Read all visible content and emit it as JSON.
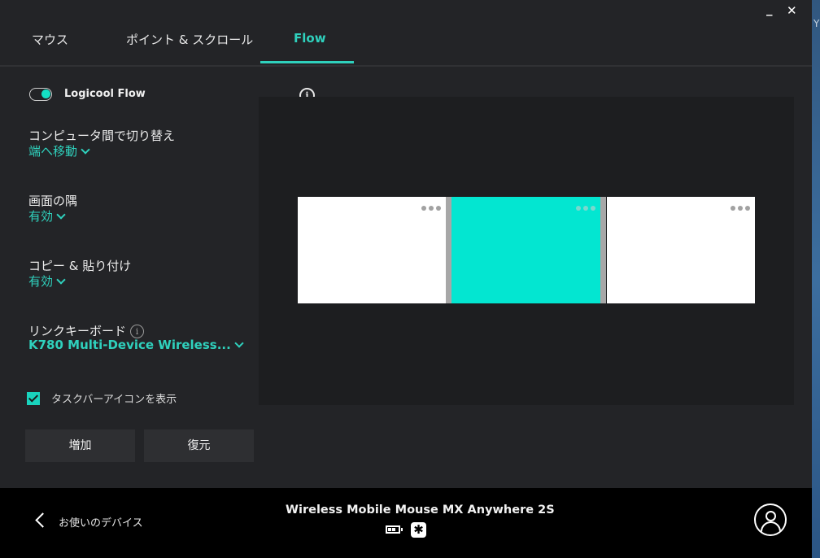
{
  "window": {
    "controls": {
      "minimize": "_",
      "close": "✕"
    }
  },
  "desktop": {
    "edge_text": "Y"
  },
  "tabs": [
    {
      "label": "マウス",
      "active": false
    },
    {
      "label": "ポイント & スクロール",
      "active": false
    },
    {
      "label": "Flow",
      "active": true
    }
  ],
  "flow": {
    "toggle": {
      "label": "Logicool Flow",
      "on": true
    },
    "settings": [
      {
        "title": "コンピュータ間で切り替え",
        "value": "端へ移動"
      },
      {
        "title": "画面の隅",
        "value": "有効"
      },
      {
        "title": "コピー & 貼り付け",
        "value": "有効"
      },
      {
        "title": "リンクキーボード",
        "value": "K780 Multi-Device Wireless...",
        "info_icon": "i"
      }
    ],
    "taskbar_checkbox": {
      "label": "タスクバーアイコンを表示",
      "checked": true
    },
    "buttons": {
      "add": "増加",
      "restore": "復元"
    },
    "info_icon": "i",
    "screens": [
      {
        "name": "computer-1",
        "active": false
      },
      {
        "name": "computer-2",
        "active": true
      },
      {
        "name": "computer-3",
        "active": false
      }
    ]
  },
  "footer": {
    "back_label": "お使いのデバイス",
    "device_name": "Wireless Mobile Mouse MX Anywhere 2S",
    "battery_level": "2/3",
    "receiver_icon": "✱",
    "colors": {
      "accent": "#2fd1bd",
      "active_screen": "#03e6d1"
    }
  }
}
